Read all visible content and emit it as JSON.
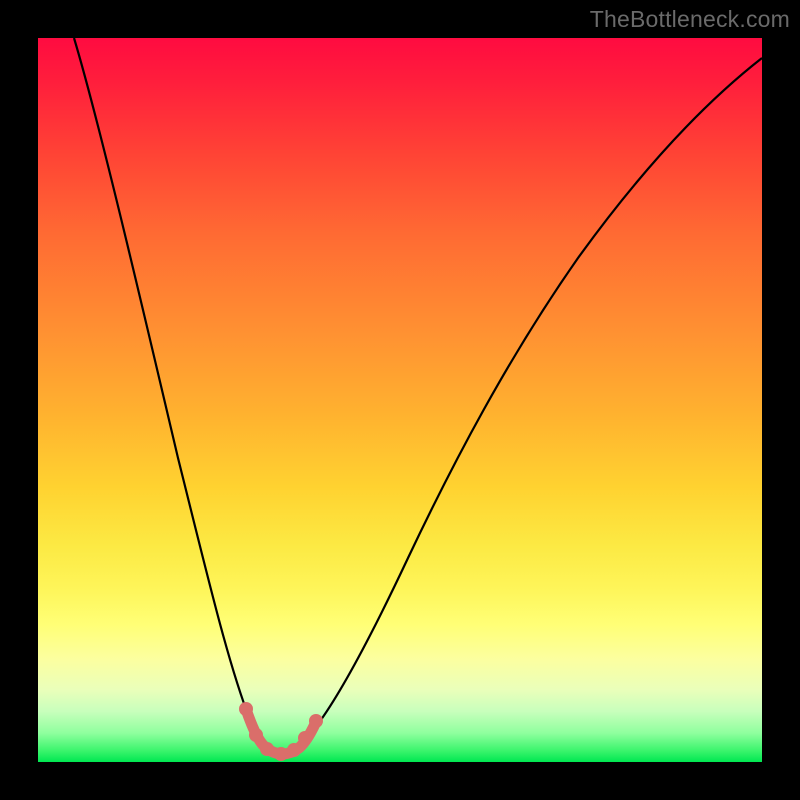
{
  "watermark": "TheBottleneck.com",
  "colors": {
    "pink_stroke": "#da6e6a",
    "curve_stroke": "#000000"
  },
  "chart_data": {
    "type": "line",
    "title": "",
    "xlabel": "",
    "ylabel": "",
    "xlim": [
      0,
      100
    ],
    "ylim": [
      0,
      100
    ],
    "grid": false,
    "legend": false,
    "series": [
      {
        "name": "bottleneck-curve",
        "x": [
          5,
          8,
          11,
          14,
          17,
          20,
          22,
          24,
          26,
          28,
          30,
          32,
          33.5,
          36,
          40,
          45,
          50,
          55,
          60,
          65,
          70,
          75,
          80,
          85,
          90,
          95,
          100
        ],
        "y": [
          100,
          90,
          80,
          70,
          60,
          48,
          40,
          30,
          20,
          12,
          6,
          3,
          2,
          3,
          8,
          18,
          27,
          36,
          44,
          52,
          59,
          65,
          71,
          76,
          80,
          84,
          86
        ]
      },
      {
        "name": "highlight-near-minimum",
        "x": [
          29,
          30.5,
          32,
          33.5,
          35,
          36.5,
          38
        ],
        "y": [
          8,
          4.5,
          2.5,
          2,
          2.5,
          4,
          6
        ]
      }
    ],
    "minimum": {
      "x": 33.5,
      "y": 2
    }
  }
}
